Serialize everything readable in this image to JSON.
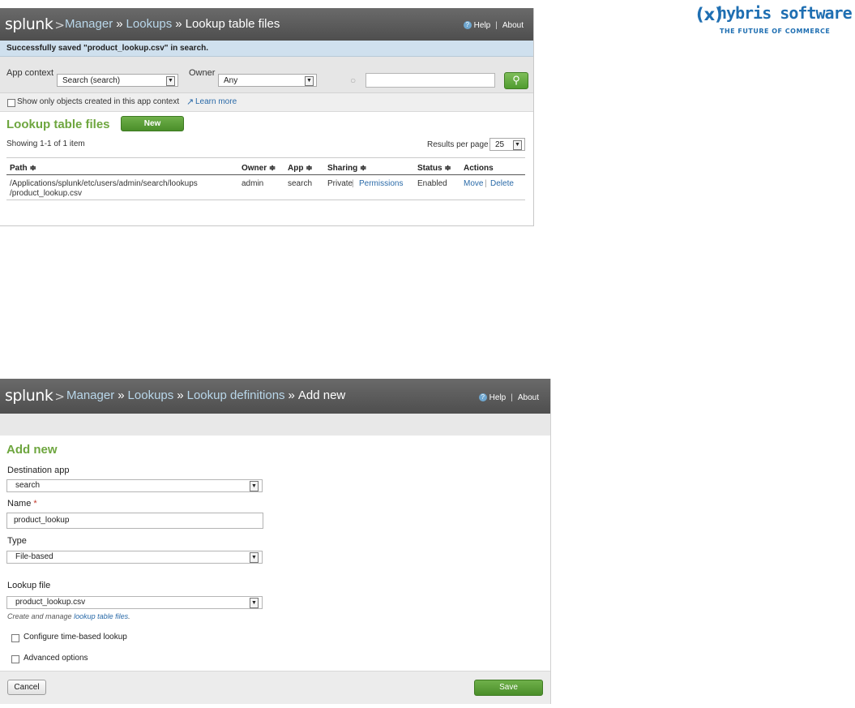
{
  "brand_logo": "splunk",
  "brand_arrow": ">",
  "hybris": {
    "mark": "(x)",
    "name": "hybris software",
    "tagline": "THE FUTURE OF COMMERCE",
    "color": "#1f6fb2"
  },
  "panel1": {
    "breadcrumbs": [
      "Manager",
      "Lookups",
      "Lookup table files"
    ],
    "separator": "»",
    "help_label": "Help",
    "about_label": "About",
    "message": "Successfully saved \"product_lookup.csv\" in search.",
    "app_context_label": "App context",
    "app_context_value": "Search (search)",
    "owner_label": "Owner",
    "owner_value": "Any",
    "search_value": "",
    "search_icon": "search-icon",
    "show_only_label": "Show only objects created in this app context",
    "learn_more_label": "Learn more",
    "section_title": "Lookup table files",
    "new_button_label": "New",
    "showing_text": "Showing 1-1 of 1 item",
    "results_per_page_label": "Results per page",
    "results_per_page_value": "25",
    "columns": [
      "Path ≑",
      "Owner ≑",
      "App ≑",
      "Sharing ≑",
      "Status ≑",
      "Actions"
    ],
    "row": {
      "path_line1": "/Applications/splunk/etc/users/admin/search/lookups",
      "path_line2": "/product_lookup.csv",
      "owner": "admin",
      "app": "search",
      "sharing": "Private",
      "permissions_label": "Permissions",
      "status": "Enabled",
      "move_label": "Move",
      "delete_label": "Delete"
    }
  },
  "panel2": {
    "breadcrumbs": [
      "Manager",
      "Lookups",
      "Lookup definitions",
      "Add new"
    ],
    "separator": "»",
    "help_label": "Help",
    "about_label": "About",
    "section_title": "Add new",
    "destination_app_label": "Destination app",
    "destination_app_value": "search",
    "name_label": "Name",
    "name_required": "*",
    "name_value": "product_lookup",
    "type_label": "Type",
    "type_value": "File-based",
    "lookup_file_label": "Lookup file",
    "lookup_file_value": "product_lookup.csv",
    "help_text_prefix": "Create and manage",
    "help_text_link": "lookup table files",
    "help_text_suffix": ".",
    "time_based_label": "Configure time-based lookup",
    "advanced_label": "Advanced options",
    "cancel_label": "Cancel",
    "save_label": "Save"
  },
  "colors": {
    "header_bg": "#5d5d5d",
    "accent_green": "#6ea63f",
    "link_blue": "#2a6aa8",
    "message_bg": "#cfe0ee"
  }
}
